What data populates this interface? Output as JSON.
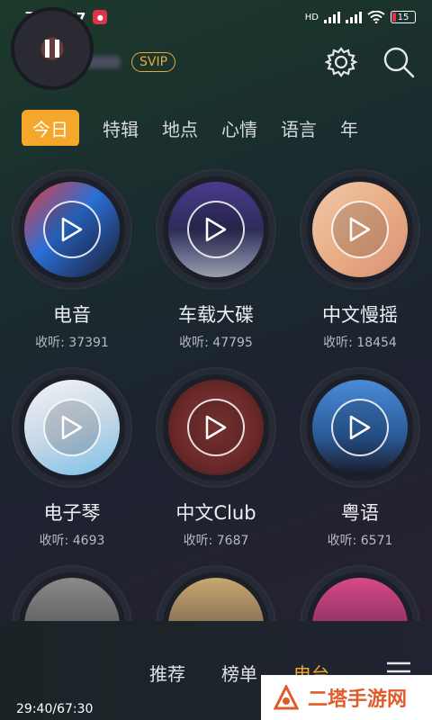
{
  "status": {
    "time": "下午4:27",
    "network": "HD",
    "battery": "15"
  },
  "header": {
    "svip_label": "SVIP"
  },
  "tabs": [
    "今日",
    "特辑",
    "地点",
    "心情",
    "语言",
    "年"
  ],
  "cards": [
    {
      "title": "电音",
      "plays": "收听: 37391"
    },
    {
      "title": "车载大碟",
      "plays": "收听: 47795"
    },
    {
      "title": "中文慢摇",
      "plays": "收听: 18454"
    },
    {
      "title": "电子琴",
      "plays": "收听: 4693"
    },
    {
      "title": "中文Club",
      "plays": "收听: 7687"
    },
    {
      "title": "粤语",
      "plays": "收听: 6571"
    }
  ],
  "player": {
    "time": "29:40/67:30"
  },
  "nav": [
    "推荐",
    "榜单",
    "电台"
  ],
  "watermark": "二塔手游网",
  "colors": {
    "accent": "#f4a72a",
    "svip": "#e9a93c"
  }
}
